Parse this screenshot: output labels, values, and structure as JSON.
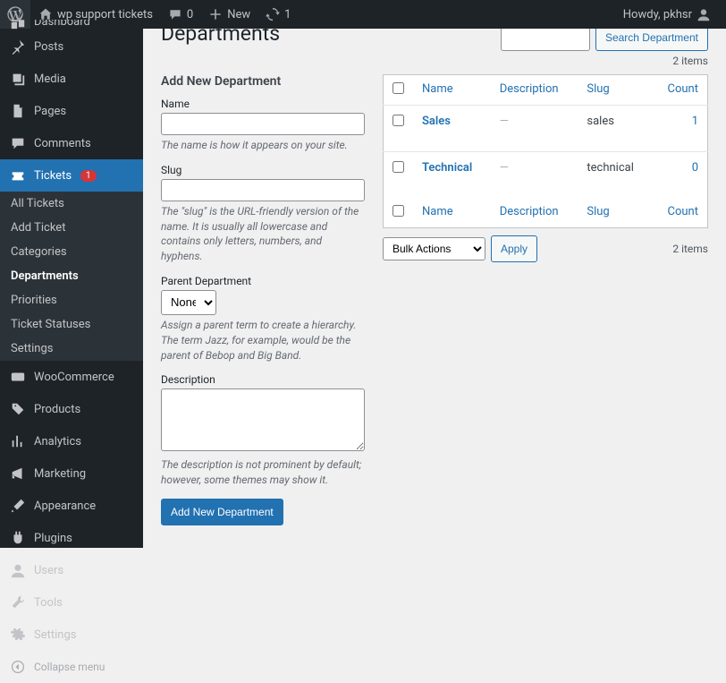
{
  "adminbar": {
    "site_name": "wp support tickets",
    "comments_count": "0",
    "new_label": "New",
    "updates_count": "1",
    "greeting": "Howdy, pkhsr"
  },
  "menu": {
    "dashboard": "Dashboard",
    "posts": "Posts",
    "media": "Media",
    "pages": "Pages",
    "comments": "Comments",
    "tickets": "Tickets",
    "tickets_badge": "1",
    "woocommerce": "WooCommerce",
    "products": "Products",
    "analytics": "Analytics",
    "marketing": "Marketing",
    "appearance": "Appearance",
    "plugins": "Plugins",
    "users": "Users",
    "tools": "Tools",
    "settings": "Settings",
    "collapse": "Collapse menu"
  },
  "submenu": {
    "all_tickets": "All Tickets",
    "add_ticket": "Add Ticket",
    "categories": "Categories",
    "departments": "Departments",
    "priorities": "Priorities",
    "ticket_statuses": "Ticket Statuses",
    "settings": "Settings"
  },
  "page": {
    "title": "Departments",
    "search_btn": "Search Department",
    "items_count": "2 items",
    "form_title": "Add New Department",
    "submit_btn": "Add New Department"
  },
  "form": {
    "name": {
      "label": "Name",
      "hint": "The name is how it appears on your site."
    },
    "slug": {
      "label": "Slug",
      "hint": "The \"slug\" is the URL-friendly version of the name. It is usually all lowercase and contains only letters, numbers, and hyphens."
    },
    "parent": {
      "label": "Parent Department",
      "option_none": "None",
      "hint": "Assign a parent term to create a hierarchy. The term Jazz, for example, would be the parent of Bebop and Big Band."
    },
    "description": {
      "label": "Description",
      "hint": "The description is not prominent by default; however, some themes may show it."
    }
  },
  "table": {
    "cols": {
      "name": "Name",
      "description": "Description",
      "slug": "Slug",
      "count": "Count"
    },
    "rows": [
      {
        "name": "Sales",
        "description": "—",
        "slug": "sales",
        "count": "1"
      },
      {
        "name": "Technical",
        "description": "—",
        "slug": "technical",
        "count": "0"
      }
    ],
    "bulk_label": "Bulk Actions",
    "apply": "Apply"
  }
}
